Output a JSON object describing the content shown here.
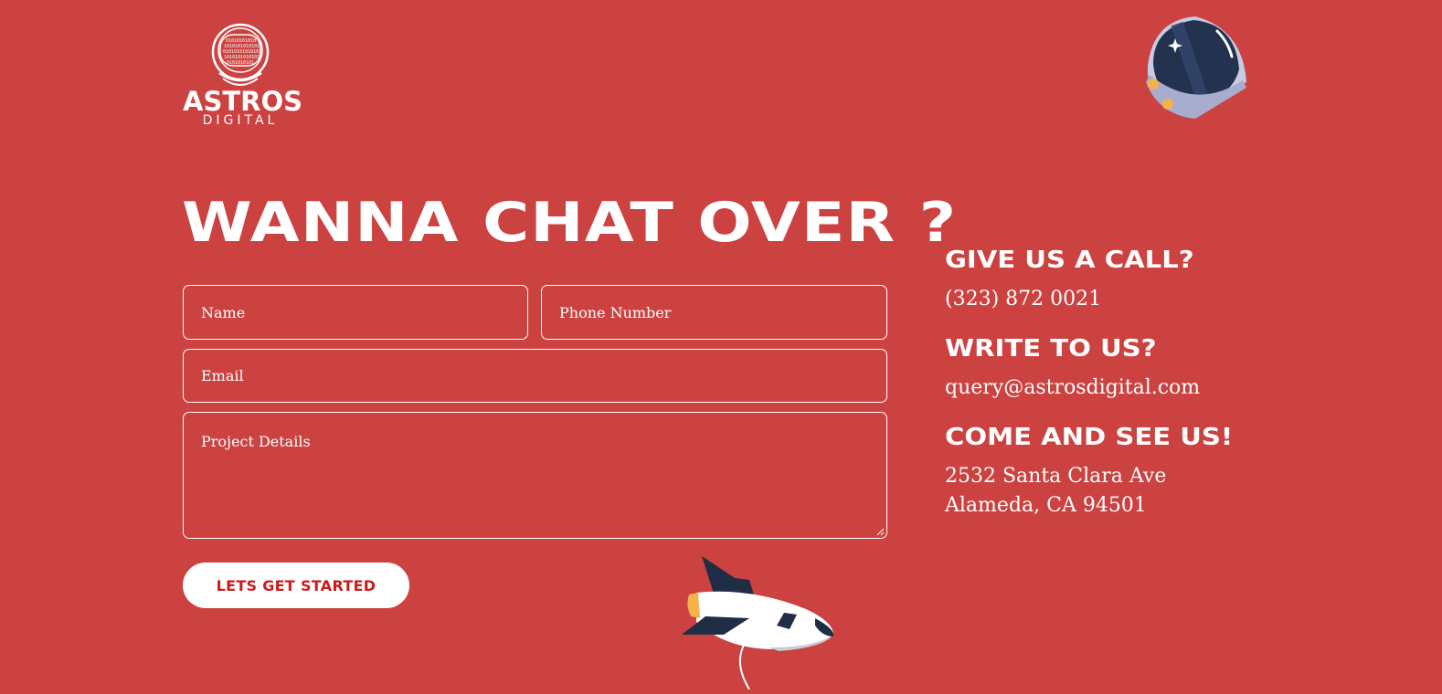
{
  "brand": {
    "name": "ASTROS",
    "sub": "DIGITAL"
  },
  "headline": "WANNA CHAT OVER ?",
  "form": {
    "name_placeholder": "Name",
    "phone_placeholder": "Phone Number",
    "email_placeholder": "Email",
    "details_placeholder": "Project Details",
    "submit_label": "LETS GET STARTED"
  },
  "contact": {
    "call_heading": "GIVE US A CALL?",
    "phone": "(323) 872 0021",
    "write_heading": "WRITE TO US?",
    "email": "query@astrosdigital.com",
    "visit_heading": "COME AND SEE US!",
    "address_line1": "2532 Santa Clara Ave",
    "address_line2": "Alameda, CA 94501"
  },
  "colors": {
    "background": "#cb4240",
    "button_text": "#cc1a1a",
    "white": "#ffffff"
  },
  "icons": [
    "astronaut-helmet-logo-icon",
    "space-helmet-icon",
    "rocket-icon"
  ]
}
